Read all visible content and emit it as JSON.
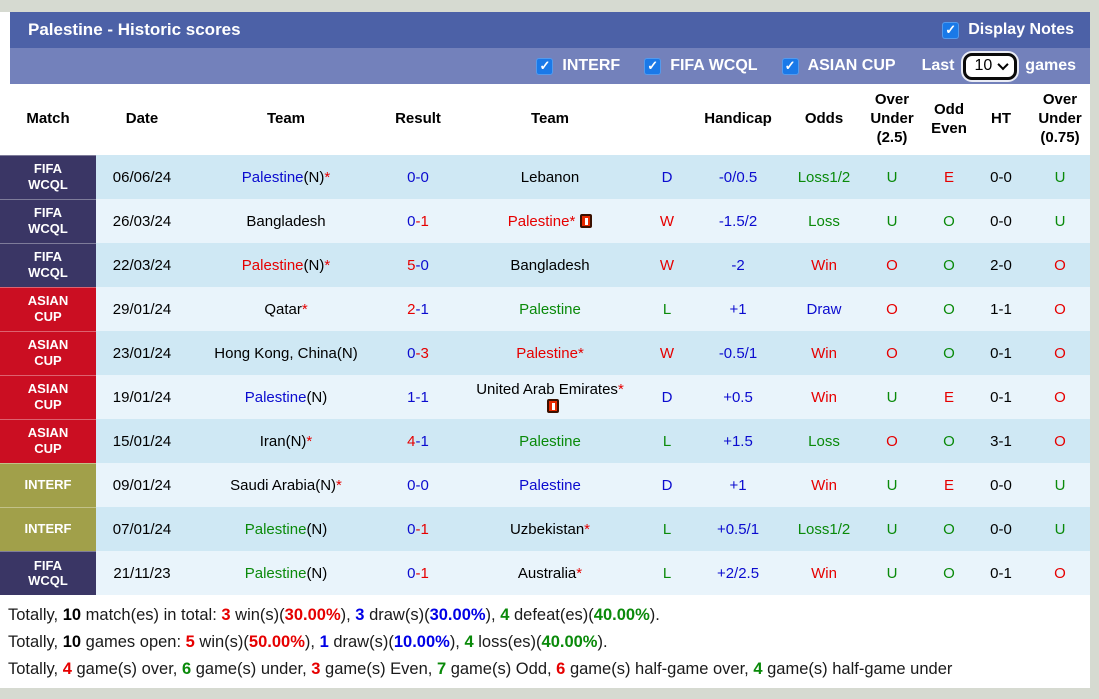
{
  "colors": {
    "title_bar": "#4c61a7",
    "filter_bar": "#7381bb",
    "fifa_wcql_cell": "#3a3665",
    "asian_cup_cell": "#cb0e22",
    "interf_cell": "#a1a04a",
    "row_dark": "#cfe8f4",
    "row_light": "#e9f4fb",
    "checkbox_blue": "#1a79e8",
    "win_red": "#e60000",
    "draw_blue": "#0b0bcf",
    "loss_green": "#0a8a0a"
  },
  "header": {
    "title": "Palestine - Historic scores",
    "display_notes": {
      "label": "Display Notes",
      "checked": true
    }
  },
  "filter_bar": {
    "competitions": [
      {
        "label": "INTERF",
        "checked": true
      },
      {
        "label": "FIFA WCQL",
        "checked": true
      },
      {
        "label": "ASIAN CUP",
        "checked": true
      }
    ],
    "last_label": "Last",
    "last_value": "10",
    "games_label": "games"
  },
  "table": {
    "columns": [
      "Match",
      "Date",
      "Team",
      "Result",
      "Team",
      "",
      "Handicap",
      "Odds",
      "Over\nUnder\n(2.5)",
      "Odd\nEven",
      "HT",
      "Over\nUnder\n(0.75)"
    ],
    "rows": [
      {
        "comp": "FIFA\nWCQL",
        "comp_class": "fifa",
        "date": "06/06/24",
        "home": {
          "name": "Palestine",
          "suffix": "(N)",
          "star": true,
          "color": "blue"
        },
        "score": {
          "h": "0",
          "a": "0",
          "hc": "blue",
          "ac": "blue"
        },
        "away": {
          "name": "Lebanon",
          "color": "black"
        },
        "outcome": {
          "t": "D",
          "c": "blue"
        },
        "handicap": "-0/0.5",
        "odds": {
          "t": "Loss1/2",
          "c": "green"
        },
        "ou25": {
          "t": "U",
          "c": "green"
        },
        "oe": {
          "t": "E",
          "c": "red"
        },
        "ht": "0-0",
        "ou075": {
          "t": "U",
          "c": "green"
        }
      },
      {
        "comp": "FIFA\nWCQL",
        "comp_class": "fifa",
        "date": "26/03/24",
        "home": {
          "name": "Bangladesh",
          "color": "black"
        },
        "score": {
          "h": "0",
          "a": "1",
          "hc": "blue",
          "ac": "red"
        },
        "away": {
          "name": "Palestine",
          "star": true,
          "color": "red",
          "red_card": "inline"
        },
        "outcome": {
          "t": "W",
          "c": "red"
        },
        "handicap": "-1.5/2",
        "odds": {
          "t": "Loss",
          "c": "green"
        },
        "ou25": {
          "t": "U",
          "c": "green"
        },
        "oe": {
          "t": "O",
          "c": "green"
        },
        "ht": "0-0",
        "ou075": {
          "t": "U",
          "c": "green"
        }
      },
      {
        "comp": "FIFA\nWCQL",
        "comp_class": "fifa",
        "date": "22/03/24",
        "home": {
          "name": "Palestine",
          "suffix": "(N)",
          "star": true,
          "color": "red"
        },
        "score": {
          "h": "5",
          "a": "0",
          "hc": "red",
          "ac": "blue"
        },
        "away": {
          "name": "Bangladesh",
          "color": "black"
        },
        "outcome": {
          "t": "W",
          "c": "red"
        },
        "handicap": "-2",
        "odds": {
          "t": "Win",
          "c": "red"
        },
        "ou25": {
          "t": "O",
          "c": "red"
        },
        "oe": {
          "t": "O",
          "c": "green"
        },
        "ht": "2-0",
        "ou075": {
          "t": "O",
          "c": "red"
        }
      },
      {
        "comp": "ASIAN\nCUP",
        "comp_class": "asian",
        "date": "29/01/24",
        "home": {
          "name": "Qatar",
          "star": true,
          "color": "black"
        },
        "score": {
          "h": "2",
          "a": "1",
          "hc": "red",
          "ac": "blue"
        },
        "away": {
          "name": "Palestine",
          "color": "green"
        },
        "outcome": {
          "t": "L",
          "c": "green"
        },
        "handicap": "+1",
        "odds": {
          "t": "Draw",
          "c": "blue"
        },
        "ou25": {
          "t": "O",
          "c": "red"
        },
        "oe": {
          "t": "O",
          "c": "green"
        },
        "ht": "1-1",
        "ou075": {
          "t": "O",
          "c": "red"
        }
      },
      {
        "comp": "ASIAN\nCUP",
        "comp_class": "asian",
        "date": "23/01/24",
        "home": {
          "name": "Hong Kong, China",
          "suffix": "(N)",
          "color": "black"
        },
        "score": {
          "h": "0",
          "a": "3",
          "hc": "blue",
          "ac": "red"
        },
        "away": {
          "name": "Palestine",
          "star": true,
          "color": "red"
        },
        "outcome": {
          "t": "W",
          "c": "red"
        },
        "handicap": "-0.5/1",
        "odds": {
          "t": "Win",
          "c": "red"
        },
        "ou25": {
          "t": "O",
          "c": "red"
        },
        "oe": {
          "t": "O",
          "c": "green"
        },
        "ht": "0-1",
        "ou075": {
          "t": "O",
          "c": "red"
        }
      },
      {
        "comp": "ASIAN\nCUP",
        "comp_class": "asian",
        "date": "19/01/24",
        "home": {
          "name": "Palestine",
          "suffix": "(N)",
          "color": "blue"
        },
        "score": {
          "h": "1",
          "a": "1",
          "hc": "blue",
          "ac": "blue"
        },
        "away": {
          "name": "United Arab Emirates",
          "star": true,
          "color": "black",
          "red_card": "below"
        },
        "outcome": {
          "t": "D",
          "c": "blue"
        },
        "handicap": "+0.5",
        "odds": {
          "t": "Win",
          "c": "red"
        },
        "ou25": {
          "t": "U",
          "c": "green"
        },
        "oe": {
          "t": "E",
          "c": "red"
        },
        "ht": "0-1",
        "ou075": {
          "t": "O",
          "c": "red"
        }
      },
      {
        "comp": "ASIAN\nCUP",
        "comp_class": "asian",
        "date": "15/01/24",
        "home": {
          "name": "Iran",
          "suffix": "(N)",
          "star": true,
          "color": "black"
        },
        "score": {
          "h": "4",
          "a": "1",
          "hc": "red",
          "ac": "blue"
        },
        "away": {
          "name": "Palestine",
          "color": "green"
        },
        "outcome": {
          "t": "L",
          "c": "green"
        },
        "handicap": "+1.5",
        "odds": {
          "t": "Loss",
          "c": "green"
        },
        "ou25": {
          "t": "O",
          "c": "red"
        },
        "oe": {
          "t": "O",
          "c": "green"
        },
        "ht": "3-1",
        "ou075": {
          "t": "O",
          "c": "red"
        }
      },
      {
        "comp": "INTERF",
        "comp_class": "interf",
        "date": "09/01/24",
        "home": {
          "name": "Saudi Arabia",
          "suffix": "(N)",
          "star": true,
          "color": "black"
        },
        "score": {
          "h": "0",
          "a": "0",
          "hc": "blue",
          "ac": "blue"
        },
        "away": {
          "name": "Palestine",
          "color": "blue"
        },
        "outcome": {
          "t": "D",
          "c": "blue"
        },
        "handicap": "+1",
        "odds": {
          "t": "Win",
          "c": "red"
        },
        "ou25": {
          "t": "U",
          "c": "green"
        },
        "oe": {
          "t": "E",
          "c": "red"
        },
        "ht": "0-0",
        "ou075": {
          "t": "U",
          "c": "green"
        }
      },
      {
        "comp": "INTERF",
        "comp_class": "interf",
        "date": "07/01/24",
        "home": {
          "name": "Palestine",
          "suffix": "(N)",
          "color": "green"
        },
        "score": {
          "h": "0",
          "a": "1",
          "hc": "blue",
          "ac": "red"
        },
        "away": {
          "name": "Uzbekistan",
          "star": true,
          "color": "black"
        },
        "outcome": {
          "t": "L",
          "c": "green"
        },
        "handicap": "+0.5/1",
        "odds": {
          "t": "Loss1/2",
          "c": "green"
        },
        "ou25": {
          "t": "U",
          "c": "green"
        },
        "oe": {
          "t": "O",
          "c": "green"
        },
        "ht": "0-0",
        "ou075": {
          "t": "U",
          "c": "green"
        }
      },
      {
        "comp": "FIFA\nWCQL",
        "comp_class": "fifa",
        "date": "21/11/23",
        "home": {
          "name": "Palestine",
          "suffix": "(N)",
          "color": "green"
        },
        "score": {
          "h": "0",
          "a": "1",
          "hc": "blue",
          "ac": "red"
        },
        "away": {
          "name": "Australia",
          "star": true,
          "color": "black"
        },
        "outcome": {
          "t": "L",
          "c": "green"
        },
        "handicap": "+2/2.5",
        "odds": {
          "t": "Win",
          "c": "red"
        },
        "ou25": {
          "t": "U",
          "c": "green"
        },
        "oe": {
          "t": "O",
          "c": "green"
        },
        "ht": "0-1",
        "ou075": {
          "t": "O",
          "c": "red"
        }
      }
    ]
  },
  "footer": {
    "lines": [
      [
        {
          "t": "Totally, "
        },
        {
          "t": "10",
          "b": 1,
          "c": "black"
        },
        {
          "t": " match(es) in total: "
        },
        {
          "t": "3",
          "b": 1,
          "c": "red"
        },
        {
          "t": " win(s)("
        },
        {
          "t": "30.00%",
          "b": 1,
          "c": "red"
        },
        {
          "t": "), "
        },
        {
          "t": "3",
          "b": 1,
          "c": "blue"
        },
        {
          "t": " draw(s)("
        },
        {
          "t": "30.00%",
          "b": 1,
          "c": "blue"
        },
        {
          "t": "), "
        },
        {
          "t": "4",
          "b": 1,
          "c": "green"
        },
        {
          "t": " defeat(es)("
        },
        {
          "t": "40.00%",
          "b": 1,
          "c": "green"
        },
        {
          "t": ")."
        }
      ],
      [
        {
          "t": "Totally, "
        },
        {
          "t": "10",
          "b": 1,
          "c": "black"
        },
        {
          "t": " games open: "
        },
        {
          "t": "5",
          "b": 1,
          "c": "red"
        },
        {
          "t": " win(s)("
        },
        {
          "t": "50.00%",
          "b": 1,
          "c": "red"
        },
        {
          "t": "), "
        },
        {
          "t": "1",
          "b": 1,
          "c": "blue"
        },
        {
          "t": " draw(s)("
        },
        {
          "t": "10.00%",
          "b": 1,
          "c": "blue"
        },
        {
          "t": "), "
        },
        {
          "t": "4",
          "b": 1,
          "c": "green"
        },
        {
          "t": " loss(es)("
        },
        {
          "t": "40.00%",
          "b": 1,
          "c": "green"
        },
        {
          "t": ")."
        }
      ],
      [
        {
          "t": "Totally, "
        },
        {
          "t": "4",
          "b": 1,
          "c": "red"
        },
        {
          "t": " game(s) over, "
        },
        {
          "t": "6",
          "b": 1,
          "c": "green"
        },
        {
          "t": " game(s) under, "
        },
        {
          "t": "3",
          "b": 1,
          "c": "red"
        },
        {
          "t": " game(s) Even, "
        },
        {
          "t": "7",
          "b": 1,
          "c": "green"
        },
        {
          "t": " game(s) Odd, "
        },
        {
          "t": "6",
          "b": 1,
          "c": "red"
        },
        {
          "t": " game(s) half-game over, "
        },
        {
          "t": "4",
          "b": 1,
          "c": "green"
        },
        {
          "t": " game(s) half-game under"
        }
      ]
    ]
  }
}
